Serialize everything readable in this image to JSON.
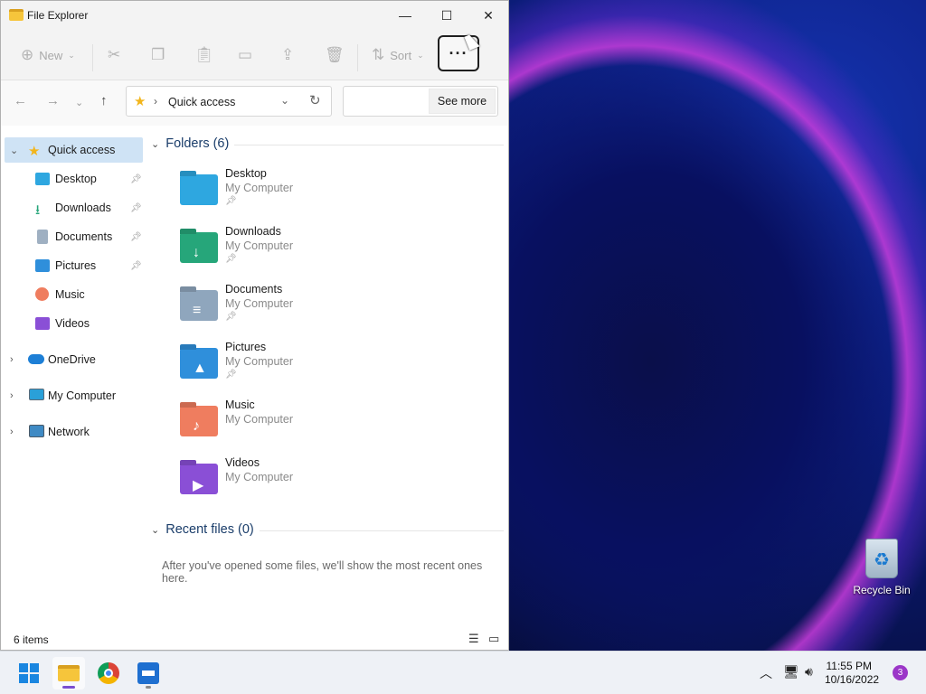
{
  "window": {
    "title": "File Explorer"
  },
  "toolbar": {
    "new_label": "New",
    "sort_label": "Sort",
    "more_label": "···"
  },
  "navbar": {
    "breadcrumb": "Quick access",
    "see_more_label": "See more"
  },
  "sidebar": {
    "quick_access": "Quick access",
    "pinned": [
      {
        "label": "Desktop",
        "icon": "desktop-icon"
      },
      {
        "label": "Downloads",
        "icon": "downloads-icon"
      },
      {
        "label": "Documents",
        "icon": "documents-icon"
      },
      {
        "label": "Pictures",
        "icon": "pictures-icon"
      },
      {
        "label": "Music",
        "icon": "music-icon"
      },
      {
        "label": "Videos",
        "icon": "videos-icon"
      }
    ],
    "roots": [
      {
        "label": "OneDrive",
        "icon": "onedrive-icon"
      },
      {
        "label": "My Computer",
        "icon": "computer-icon"
      },
      {
        "label": "Network",
        "icon": "network-icon"
      }
    ]
  },
  "content": {
    "folders_header": "Folders (6)",
    "folders": [
      {
        "name": "Desktop",
        "location": "My Computer",
        "color": "#2ea7e0"
      },
      {
        "name": "Downloads",
        "location": "My Computer",
        "color": "#26a67a"
      },
      {
        "name": "Documents",
        "location": "My Computer",
        "color": "#8fa6bd"
      },
      {
        "name": "Pictures",
        "location": "My Computer",
        "color": "#2f8fdb"
      },
      {
        "name": "Music",
        "location": "My Computer",
        "color": "#ef7d5f"
      },
      {
        "name": "Videos",
        "location": "My Computer",
        "color": "#8a4fd6"
      }
    ],
    "recent_header": "Recent files (0)",
    "recent_empty": "After you've opened some files, we'll show the most recent ones here."
  },
  "status": {
    "item_count": "6 items"
  },
  "desktop": {
    "recycle_bin_label": "Recycle Bin"
  },
  "taskbar": {
    "time": "11:55 PM",
    "date": "10/16/2022",
    "notification_count": "3"
  }
}
